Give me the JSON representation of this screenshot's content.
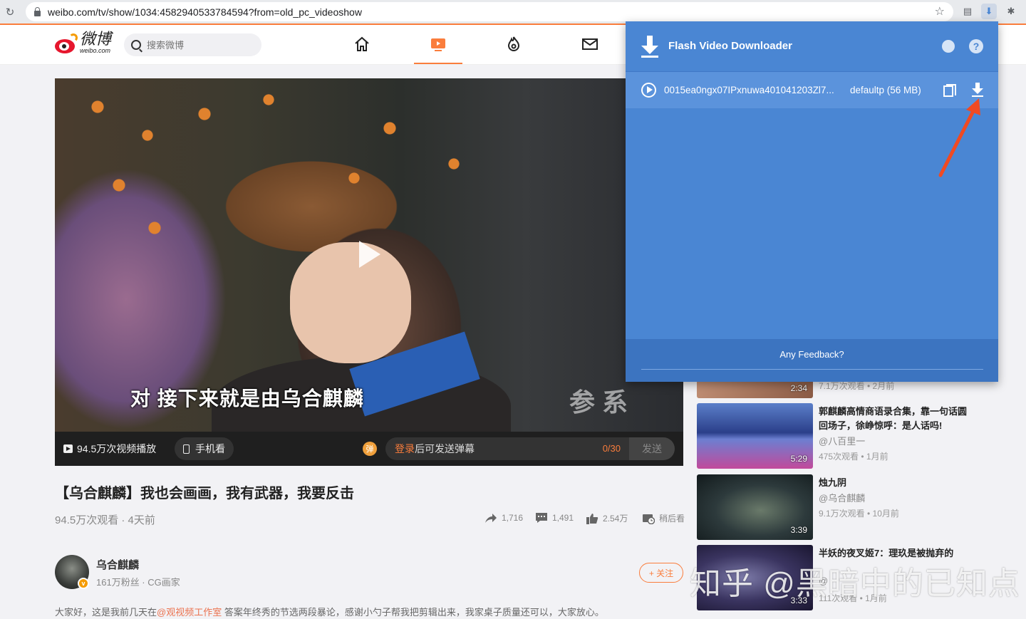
{
  "browser": {
    "url": "weibo.com/tv/show/1034:4582940533784594?from=old_pc_videoshow"
  },
  "nav": {
    "logo_cn": "微博",
    "logo_en": "weibo.com",
    "search_placeholder": "搜索微博"
  },
  "video": {
    "subtitle": "对 接下来就是由乌合麒麟",
    "overlay_brand": "参 系",
    "weibo_at": "@",
    "plays": "94.5万次视频播放",
    "mobile_label": "手机看",
    "danmu_badge": "弹",
    "danmu_login": "登录",
    "danmu_prompt": "后可发送弹幕",
    "danmu_count": "0/30",
    "send_label": "发送"
  },
  "post": {
    "title": "【乌合麒麟】我也会画画，我有武器，我要反击",
    "meta": "94.5万次观看 · 4天前",
    "shares": "1,716",
    "comments": "1,491",
    "likes": "2.54万",
    "watch_later": "稍后看",
    "author": "乌合麒麟",
    "author_sub": "161万粉丝 · CG画家",
    "follow_label": "+ 关注",
    "desc_prefix": "大家好，这是我前几天在",
    "desc_mention": "@观视频工作室",
    "desc_suffix": " 答案年终秀的节选两段暴论，感谢小勺子帮我把剪辑出来，我家桌子质量还可以，大家放心。"
  },
  "recommendations": [
    {
      "duration": "2:34",
      "stat": "7.1万次观看 • 2月前"
    },
    {
      "title": "郭麒麟高情商语录合集，靠一句话圆回场子，徐峥惊呼：是人话吗!",
      "author": "@八百里一",
      "stat": "475次观看 • 1月前",
      "duration": "5:29"
    },
    {
      "title": "烛九阴",
      "author": "@乌合麒麟",
      "stat": "9.1万次观看 • 10月前",
      "duration": "3:39"
    },
    {
      "title": "半妖的夜叉姬7：理玖是被抛弃的",
      "author": "@",
      "stat": "111次观看 • 1月前",
      "duration": "3:33"
    }
  ],
  "extension": {
    "title": "Flash Video Downloader",
    "file_name": "0015ea0ngx07IPxnuwa401041203Zl7...",
    "quality": "defaultp (56 MB)",
    "feedback": "Any Feedback?"
  },
  "watermark": "知乎 @黑暗中的已知点",
  "colors": {
    "weibo_orange": "#fa7d3c",
    "popup_blue": "#4a86d3",
    "arrow_red": "#f04a22"
  }
}
